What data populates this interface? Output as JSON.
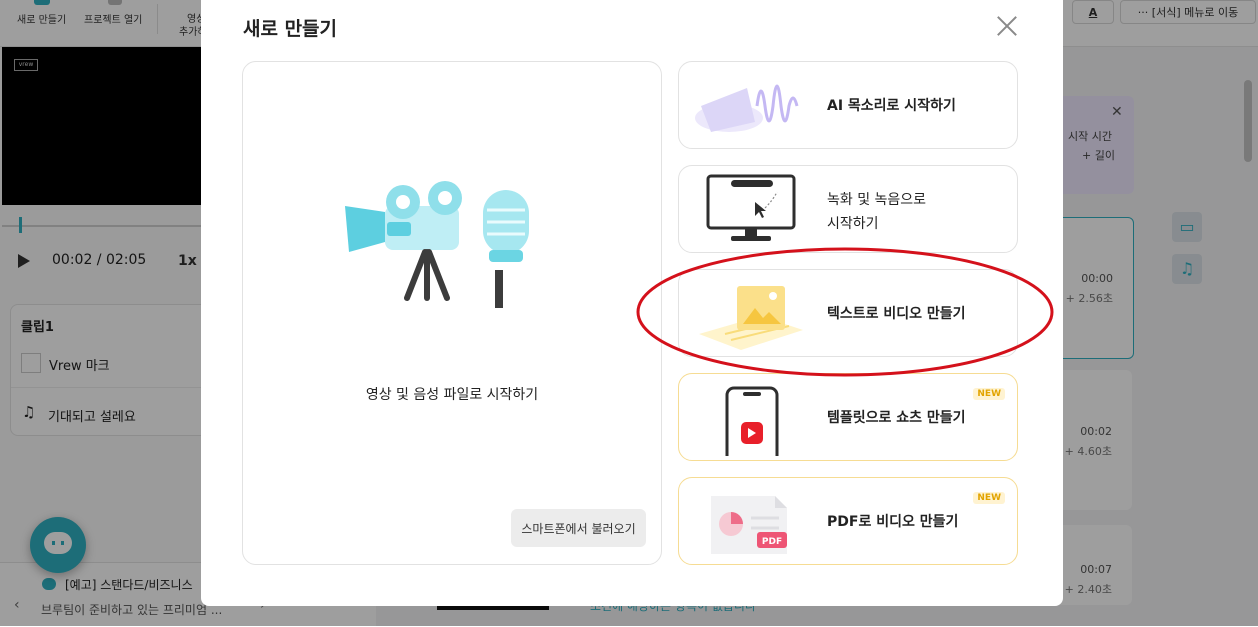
{
  "toolbar": {
    "new_label": "새로 만들기",
    "open_label": "프로젝트 열기",
    "add_label_1": "영상",
    "add_label_2": "추가하",
    "font_btn": "A",
    "menu_btn": "··· [서식] 메뉴로 이동"
  },
  "player": {
    "time": "00:02 / 02:05",
    "speed": "1x",
    "logo": "vrew"
  },
  "clip": {
    "title": "클립1",
    "check_label": "Vrew 마크",
    "music_label": "기대되고 설레요"
  },
  "notice": {
    "title": "[예고] 스탠다드/비즈니스",
    "body": "브루팀이 준비하고 있는 프리미엄 ..."
  },
  "timeline": {
    "hint_line1": "시작 시간",
    "hint_line2": "+ 길이",
    "segments": [
      {
        "time": "00:00",
        "dur": "+ 2.56초"
      },
      {
        "time": "00:02",
        "dur": "+ 4.60초"
      },
      {
        "time": "00:07",
        "dur": "+ 2.40초"
      }
    ],
    "bottom_caption": "조건에 해당하는 항목이 없습니다"
  },
  "modal": {
    "title": "새로 만들기",
    "big_card_label": "영상 및 음성 파일로 시작하기",
    "phone_button": "스마트폰에서 불러오기",
    "options": [
      {
        "label": "AI 목소리로 시작하기"
      },
      {
        "label": "녹화 및 녹음으로\n시작하기"
      },
      {
        "label": "텍스트로 비디오 만들기"
      },
      {
        "label": "템플릿으로 쇼츠 만들기",
        "badge": "NEW"
      },
      {
        "label": "PDF로 비디오 만들기",
        "badge": "NEW"
      }
    ],
    "pdf_tag": "PDF"
  },
  "colors": {
    "accent": "#2fb1c2",
    "annotation": "#d4111b",
    "new_badge": "#e2a400"
  }
}
